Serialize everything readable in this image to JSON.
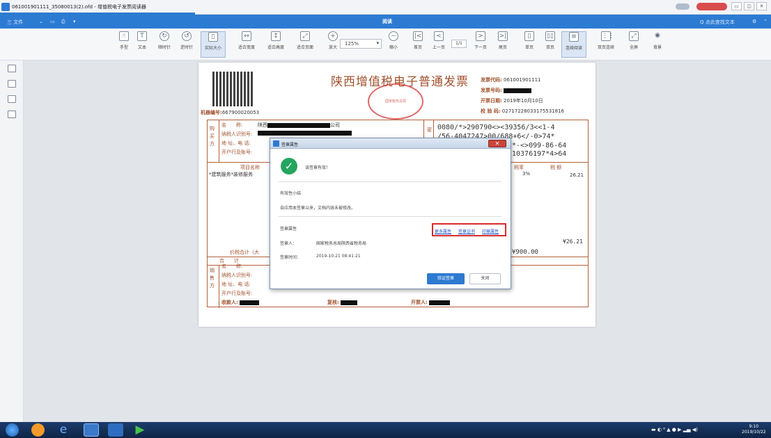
{
  "window": {
    "title": "061001901111_35080013(2).ofd - 增值税电子发票阅读器",
    "controls": [
      "▭",
      "◫",
      "✕"
    ]
  },
  "menubar": {
    "file": "三 文件",
    "center_label": "阅读",
    "search": "Q 点此查找文本"
  },
  "toolbar": {
    "items": [
      {
        "label": "手型",
        "icon": "hand-icon"
      },
      {
        "label": "文本",
        "icon": "text-select-icon"
      },
      {
        "label": "顺时针",
        "icon": "rotate-cw-icon"
      },
      {
        "label": "逆时针",
        "icon": "rotate-ccw-icon"
      },
      {
        "label": "实际大小",
        "icon": "actual-size-icon"
      },
      {
        "label": "适合宽度",
        "icon": "fit-width-icon"
      },
      {
        "label": "适合高度",
        "icon": "fit-height-icon"
      },
      {
        "label": "适合页面",
        "icon": "fit-page-icon"
      },
      {
        "label": "放大",
        "icon": "zoom-in-icon"
      },
      {
        "label": "缩小",
        "icon": "zoom-out-icon"
      },
      {
        "label": "首页",
        "icon": "first-page-icon"
      },
      {
        "label": "上一页",
        "icon": "prev-page-icon"
      },
      {
        "label": "下一页",
        "icon": "next-page-icon"
      },
      {
        "label": "尾页",
        "icon": "last-page-icon"
      },
      {
        "label": "单页",
        "icon": "single-page-icon"
      },
      {
        "label": "双页",
        "icon": "double-page-icon"
      },
      {
        "label": "连续阅读",
        "icon": "continuous-icon"
      },
      {
        "label": "双页连续",
        "icon": "double-continuous-icon"
      },
      {
        "label": "全屏",
        "icon": "fullscreen-icon"
      },
      {
        "label": "背景",
        "icon": "eye-icon"
      }
    ],
    "zoom_value": "125%",
    "page_value": "1/1"
  },
  "invoice": {
    "title": "陕西增值税电子普通发票",
    "machine_label": "机器编号:",
    "machine_no": "667900020053",
    "stamp_text": "国家税务总局",
    "code_label": "发票代码:",
    "code": "061001901111",
    "number_label": "发票号码:",
    "date_label": "开票日期:",
    "date": "2019年10月10日",
    "check_label": "校 验 码:",
    "check": "02717228033175531816",
    "buyer_label": "购买方",
    "name_label": "名　　称:",
    "buyer_name": "陕西",
    "buyer_name_suffix": "公司",
    "taxid_label": "纳税人识别号:",
    "addr_label": "地 址、电 话:",
    "bank_label": "开户行及账号:",
    "cipher_label": "密",
    "cipher": [
      "0080/*>290790<><39356/3<<1-4",
      "/56-4047247>00/688+6</-0>74*",
      "*-<>099-86-64",
      "10376197*4>64"
    ],
    "item_header": "项目名称",
    "item": "*建筑服务*装修服务",
    "rate_header": "税率",
    "tax_header": "税 额",
    "rate": "3%",
    "tax": "26.21",
    "total_label": "合　　计",
    "total_tax": "¥26.21",
    "grand_label": "价税合计（大",
    "grand_value": "¥900.00",
    "seller_label": "销售方",
    "payee_label": "收款人:",
    "reviewer_label": "复核:",
    "issuer_label": "开票人:"
  },
  "dialog": {
    "title": "签章属性",
    "message": "该签章有效！",
    "validity_heading": "有效性小结",
    "validity_text": "自应用本签章以来，文档内容未被修改。",
    "props_heading": "签章属性",
    "signer_label": "签章人：",
    "signer": "国家税务总局陕西省税务局",
    "time_label": "签章时间：",
    "time": "2019-10-21 08:41:21",
    "link_more": "更多属性",
    "link_cert": "签章证书",
    "link_seal": "印章属性",
    "verify_btn": "验证签章",
    "close_btn": "关闭"
  },
  "taskbar": {
    "time": "9:10",
    "date": "2019/10/22"
  }
}
